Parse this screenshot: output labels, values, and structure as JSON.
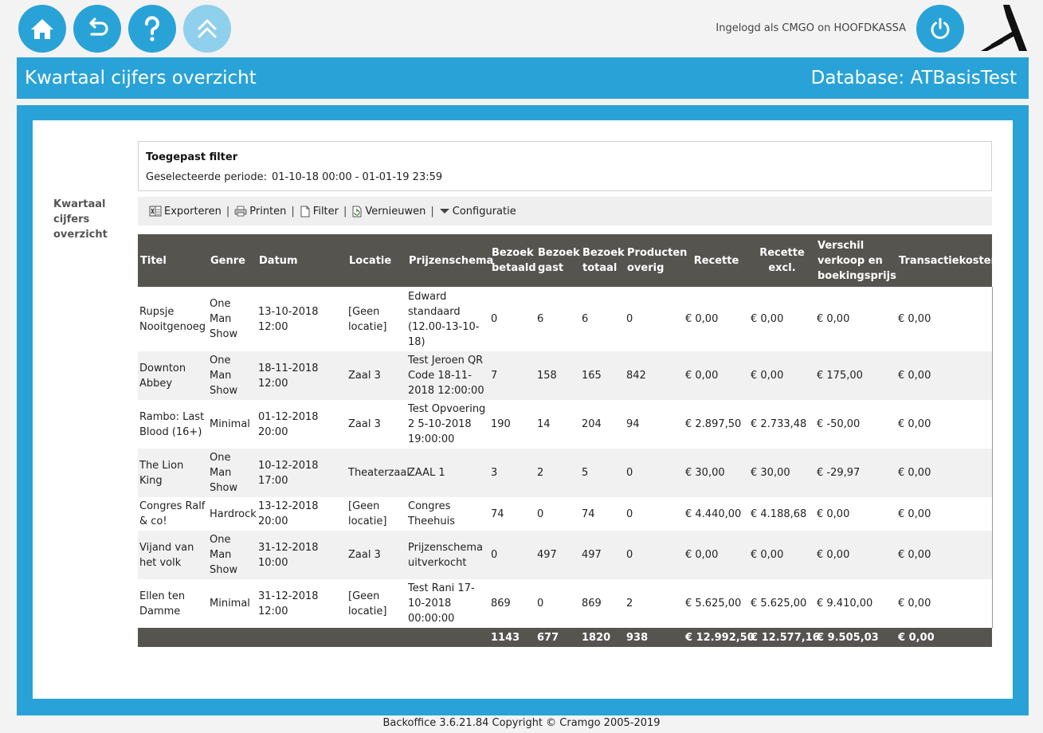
{
  "header": {
    "login_text": "Ingelogd als CMGO on HOOFDKASSA",
    "icons": [
      "home-icon",
      "back-icon",
      "help-icon",
      "scroll-up-icon",
      "power-icon"
    ]
  },
  "titlebar": {
    "title": "Kwartaal cijfers overzicht",
    "database": "Database: ATBasisTest"
  },
  "sidebar": {
    "label": "Kwartaal cijfers overzicht"
  },
  "filter": {
    "heading": "Toegepast filter",
    "period_label": "Geselecteerde periode:",
    "period_value": "01-10-18 00:00 - 01-01-19 23:59"
  },
  "toolbar": {
    "export": "Exporteren",
    "print": "Printen",
    "filter": "Filter",
    "refresh": "Vernieuwen",
    "config": "Configuratie",
    "separator": "|"
  },
  "table": {
    "columns": [
      "Titel",
      "Genre",
      "Datum",
      "Locatie",
      "Prijzenschema",
      "Bezoek betaald",
      "Bezoek gast",
      "Bezoek totaal",
      "Producten overig",
      "Recette",
      "Recette excl.",
      "Verschil verkoop en boekingsprijs",
      "Transactiekosten"
    ],
    "rows": [
      [
        "Rupsje Nooitgenoeg",
        "One Man Show",
        "13-10-2018 12:00",
        "[Geen locatie]",
        "Edward standaard (12.00-13-10-18)",
        "0",
        "6",
        "6",
        "0",
        "€ 0,00",
        "€ 0,00",
        "€ 0,00",
        "€ 0,00"
      ],
      [
        "Downton Abbey",
        "One Man Show",
        "18-11-2018 12:00",
        "Zaal 3",
        "Test Jeroen QR Code 18-11-2018 12:00:00",
        "7",
        "158",
        "165",
        "842",
        "€ 0,00",
        "€ 0,00",
        "€ 175,00",
        "€ 0,00"
      ],
      [
        "Rambo: Last Blood (16+)",
        "Minimal",
        "01-12-2018 20:00",
        "Zaal 3",
        "Test Opvoering 2 5-10-2018 19:00:00",
        "190",
        "14",
        "204",
        "94",
        "€ 2.897,50",
        "€ 2.733,48",
        "€ -50,00",
        "€ 0,00"
      ],
      [
        "The Lion King",
        "One Man Show",
        "10-12-2018 17:00",
        "Theaterzaal",
        "ZAAL 1",
        "3",
        "2",
        "5",
        "0",
        "€ 30,00",
        "€ 30,00",
        "€ -29,97",
        "€ 0,00"
      ],
      [
        "Congres Ralf & co!",
        "Hardrock",
        "13-12-2018 20:00",
        "[Geen locatie]",
        "Congres Theehuis",
        "74",
        "0",
        "74",
        "0",
        "€ 4.440,00",
        "€ 4.188,68",
        "€ 0,00",
        "€ 0,00"
      ],
      [
        "Vijand van het volk",
        "One Man Show",
        "31-12-2018 10:00",
        "Zaal 3",
        "Prijzenschema uitverkocht",
        "0",
        "497",
        "497",
        "0",
        "€ 0,00",
        "€ 0,00",
        "€ 0,00",
        "€ 0,00"
      ],
      [
        "Ellen ten Damme",
        "Minimal",
        "31-12-2018 12:00",
        "[Geen locatie]",
        "Test Rani 17-10-2018 00:00:00",
        "869",
        "0",
        "869",
        "2",
        "€ 5.625,00",
        "€ 5.625,00",
        "€ 9.410,00",
        "€ 0,00"
      ]
    ],
    "totals": [
      "",
      "",
      "",
      "",
      "",
      "1143",
      "677",
      "1820",
      "938",
      "€ 12.992,50",
      "€ 12.577,16",
      "€ 9.505,03",
      "€ 0,00"
    ]
  },
  "footer": {
    "text": "Backoffice 3.6.21.84 Copyright © Cramgo 2005-2019"
  },
  "colors": {
    "accent": "#29a3d7",
    "accent_faded": "#8fd0ec",
    "table_header": "#56544f"
  }
}
